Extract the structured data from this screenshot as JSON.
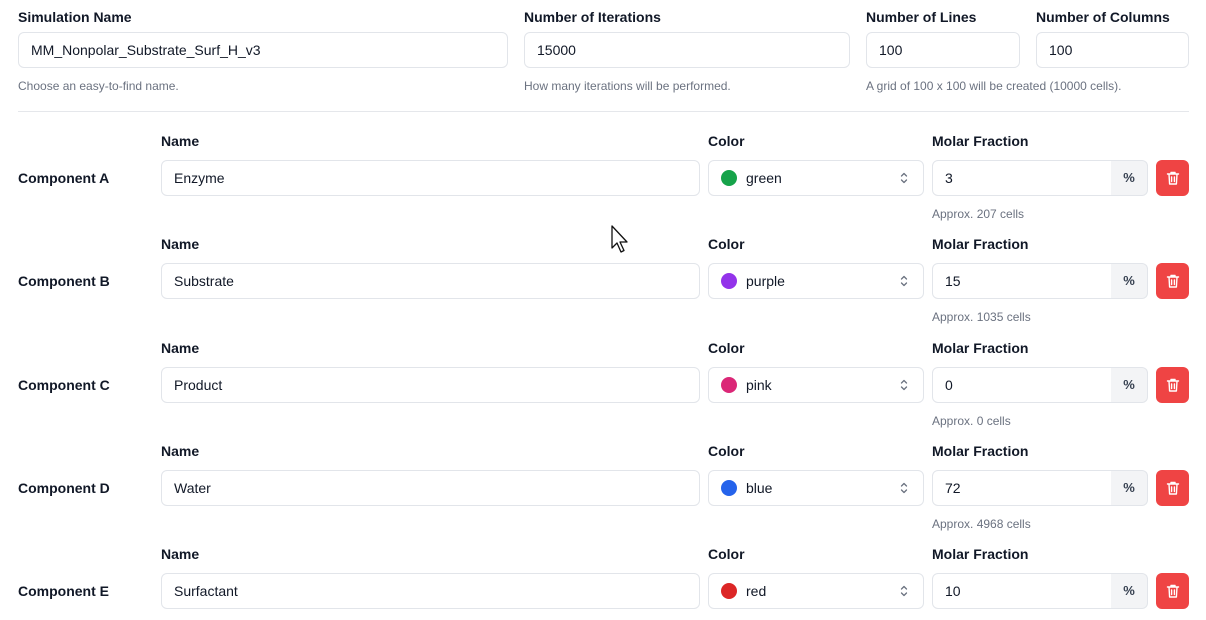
{
  "sim_name": {
    "label": "Simulation Name",
    "value": "MM_Nonpolar_Substrate_Surf_H_v3",
    "hint": "Choose an easy-to-find name."
  },
  "iterations": {
    "label": "Number of Iterations",
    "value": "15000",
    "hint": "How many iterations will be performed."
  },
  "lines": {
    "label": "Number of Lines",
    "value": "100"
  },
  "columns": {
    "label": "Number of Columns",
    "value": "100"
  },
  "grid_hint": "A grid of 100 x 100 will be created (10000 cells).",
  "column_labels": {
    "name": "Name",
    "color": "Color",
    "fraction": "Molar Fraction",
    "pct": "%"
  },
  "components": [
    {
      "label": "Component A",
      "name": "Enzyme",
      "color": "green",
      "color_hex": "#16a34a",
      "fraction": "3",
      "approx": "Approx. 207 cells"
    },
    {
      "label": "Component B",
      "name": "Substrate",
      "color": "purple",
      "color_hex": "#9333ea",
      "fraction": "15",
      "approx": "Approx. 1035 cells"
    },
    {
      "label": "Component C",
      "name": "Product",
      "color": "pink",
      "color_hex": "#db2777",
      "fraction": "0",
      "approx": "Approx. 0 cells"
    },
    {
      "label": "Component D",
      "name": "Water",
      "color": "blue",
      "color_hex": "#2563eb",
      "fraction": "72",
      "approx": "Approx. 4968 cells"
    },
    {
      "label": "Component E",
      "name": "Surfactant",
      "color": "red",
      "color_hex": "#dc2626",
      "fraction": "10",
      "approx": ""
    }
  ],
  "accent": {
    "delete": "#ef4444"
  },
  "icons": {
    "delete": "trash-icon",
    "select": "chevron-up-down-icon",
    "cursor": "mouse-pointer-icon"
  }
}
